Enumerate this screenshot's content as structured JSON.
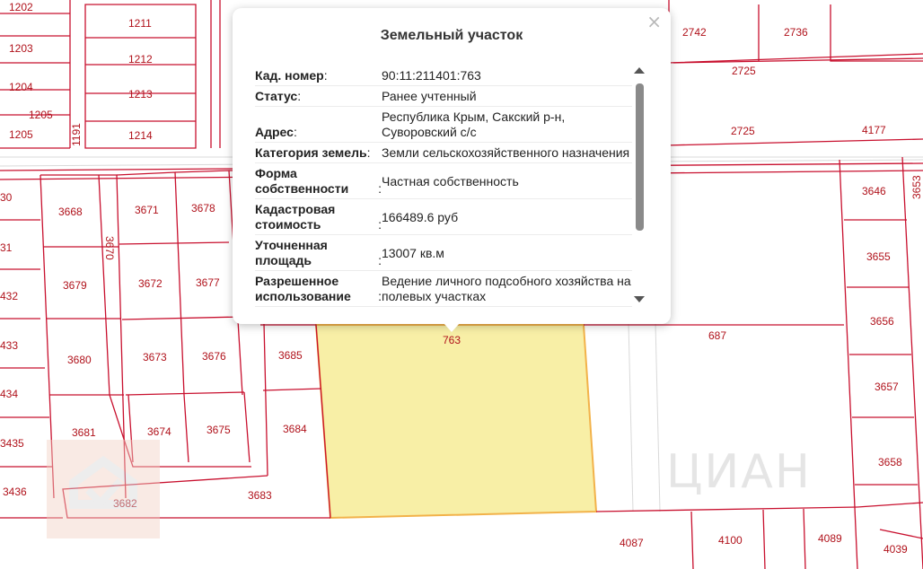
{
  "map": {
    "selected_parcel_color": "#f8efa6",
    "boundary_color": "#c8102e",
    "labels": [
      "1202",
      "1211",
      "1203",
      "1212",
      "1204",
      "1213",
      "1205",
      "1205",
      "1214",
      "1191",
      "2742",
      "2736",
      "2725",
      "2725",
      "4177",
      "30",
      "3668",
      "3671",
      "3678",
      "31",
      "3670",
      "432",
      "3679",
      "3672",
      "3677",
      "433",
      "3680",
      "3673",
      "3676",
      "3685",
      "434",
      "3681",
      "3674",
      "3675",
      "3684",
      "3435",
      "3436",
      "3682",
      "3683",
      "763",
      "687",
      "3646",
      "3653",
      "3655",
      "3656",
      "3657",
      "3658",
      "4087",
      "4100",
      "4089",
      "4039"
    ]
  },
  "watermark": {
    "text": "ЦИАН"
  },
  "popup": {
    "title": "Земельный участок",
    "close": "×",
    "rows": [
      {
        "key": "Кад. номер",
        "value": "90:11:211401:763"
      },
      {
        "key": "Статус",
        "value": "Ранее учтенный"
      },
      {
        "key": "Адрес",
        "value": "Республика Крым, Сакский р-н, Суворовский с/с"
      },
      {
        "key": "Категория земель",
        "value": "Земли сельскохозяйственного назначения"
      },
      {
        "key": "Форма собственности",
        "value": "Частная собственность"
      },
      {
        "key": "Кадастровая стоимость",
        "value": "166489.6 руб"
      },
      {
        "key": "Уточненная площадь",
        "value": "13007 кв.м"
      },
      {
        "key": "Разрешенное использование",
        "value": "Ведение личного подсобного хозяйства на полевых участках"
      }
    ]
  }
}
